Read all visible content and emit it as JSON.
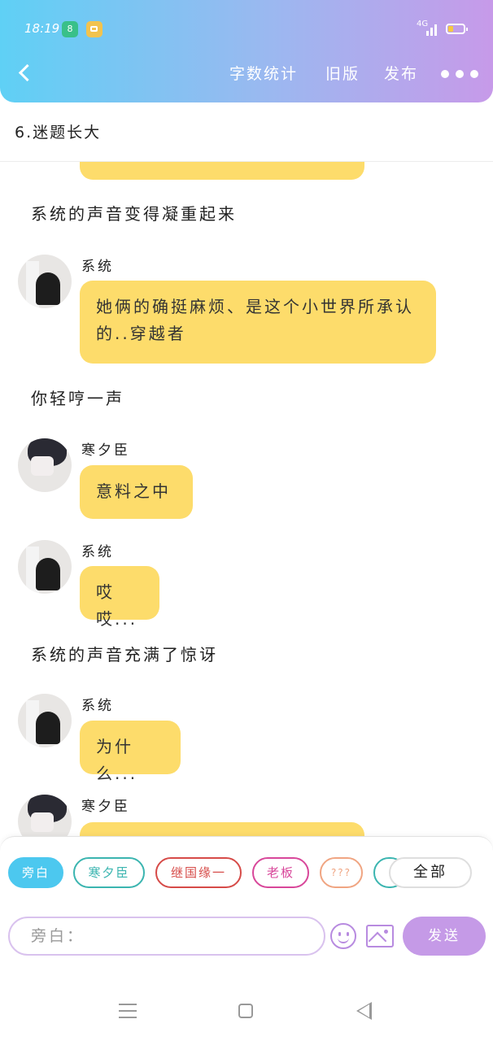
{
  "status_bar": {
    "time": "18:19",
    "network": "4G",
    "app_badge": "8"
  },
  "header": {
    "actions": [
      "字数统计",
      "旧版",
      "发布"
    ]
  },
  "chapter": {
    "title": "6.迷题长大"
  },
  "chat": {
    "narrations": [
      "系统的声音变得凝重起来",
      "你轻哼一声",
      "系统的声音充满了惊讶"
    ],
    "messages": [
      {
        "speaker": "系统",
        "text": "她俩的确挺麻烦、是这个小世界所承认的..穿越者"
      },
      {
        "speaker": "寒夕臣",
        "text": "意料之中"
      },
      {
        "speaker": "系统",
        "text": "哎哎..."
      },
      {
        "speaker": "系统",
        "text": "为什么..."
      },
      {
        "speaker": "寒夕臣",
        "text": ""
      }
    ]
  },
  "input_panel": {
    "chips": [
      {
        "label": "旁白",
        "color": "#4cc8ef"
      },
      {
        "label": "寒夕臣",
        "color": "#3bb5b0"
      },
      {
        "label": "继国缘一",
        "color": "#d64b48"
      },
      {
        "label": "老板",
        "color": "#d8479a"
      },
      {
        "label": "???",
        "color": "#f0a582"
      }
    ],
    "all_label": "全部",
    "input_placeholder": "旁白：",
    "send_label": "发送"
  }
}
